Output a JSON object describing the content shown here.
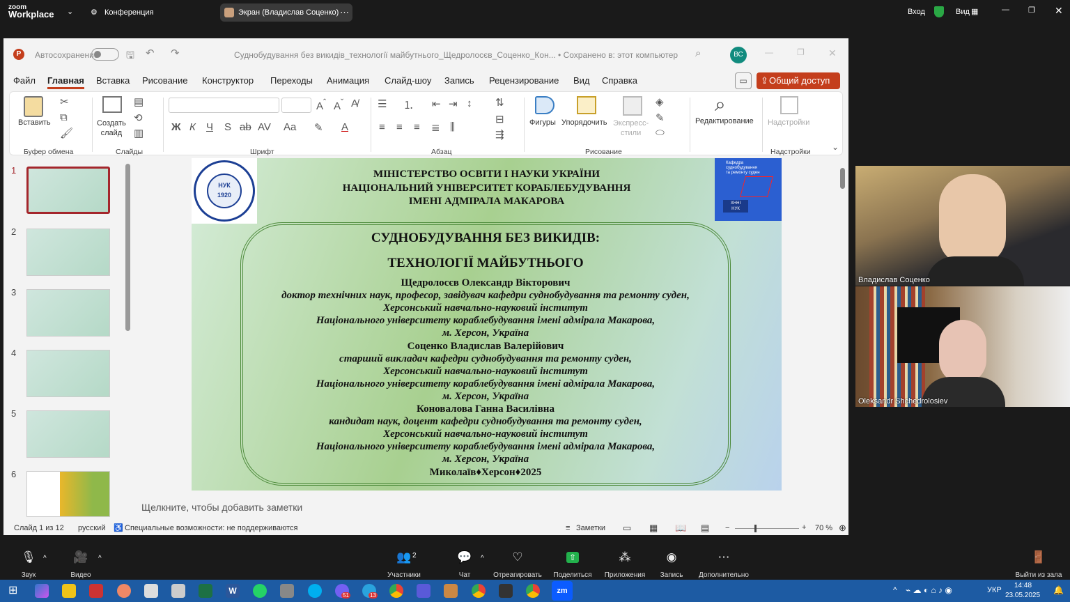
{
  "zoom_top": {
    "brand_line1": "zoom",
    "brand_line2": "Workplace",
    "meeting": "Конференция",
    "share_label": "Экран (Владислав Соценко)",
    "signin": "Вход",
    "view": "Вид"
  },
  "ppt": {
    "autosave": "Автосохранение",
    "doc_title": "Суднобудування без викидів_технології майбутнього_Щедролосєв_Соценко_Кон... • Сохранено в: этот компьютер",
    "user_initials": "ВС",
    "menu": [
      "Файл",
      "Главная",
      "Вставка",
      "Рисование",
      "Конструктор",
      "Переходы",
      "Анимация",
      "Слайд-шоу",
      "Запись",
      "Рецензирование",
      "Вид",
      "Справка"
    ],
    "share_button": "Общий доступ",
    "ribbon": {
      "paste": "Вставить",
      "new_slide_1": "Создать",
      "new_slide_2": "слайд",
      "shapes": "Фигуры",
      "arrange": "Упорядочить",
      "quick_styles_1": "Экспресс-",
      "quick_styles_2": "стили",
      "editing": "Редактирование",
      "addins": "Надстройки",
      "groups": [
        "Буфер обмена",
        "Слайды",
        "Шрифт",
        "Абзац",
        "Рисование",
        "Надстройки"
      ]
    },
    "thumb_numbers": [
      "1",
      "2",
      "3",
      "4",
      "5",
      "6"
    ],
    "notes_placeholder": "Щелкните, чтобы добавить заметки",
    "status": {
      "slide_of": "Слайд 1 из 12",
      "language": "русский",
      "accessibility": "Специальные возможности: не поддерживаются",
      "notes": "Заметки",
      "zoom": "70 %"
    }
  },
  "slide": {
    "header": [
      "МІНІСТЕРСТВО ОСВІТИ І НАУКИ УКРАЇНИ",
      "НАЦІОНАЛЬНИЙ УНІВЕРСИТЕТ КОРАБЛЕБУДУВАННЯ",
      "ІМЕНІ АДМІРАЛА МАКАРОВА"
    ],
    "logo_text": "НУК",
    "logo_year": "1920",
    "badge_lines": [
      "Кафедра",
      "суднобудування",
      "та ремонту суден"
    ],
    "badge_bottom": [
      "ХННІ",
      "НУК"
    ],
    "title1": "СУДНОБУДУВАННЯ БЕЗ ВИКИДІВ:",
    "title2": "ТЕХНОЛОГІЇ МАЙБУТНЬОГО",
    "author1_name": "Щедролосєв Олександр Вікторович",
    "author1_l1": "доктор технічних наук, професор, завідувач кафедри суднобудування та ремонту суден,",
    "author1_l2": "Херсонський навчально-науковий інститут",
    "author1_l3": "Національного університету кораблебудування імені адмірала Макарова,",
    "author1_l4": "м. Херсон, Україна",
    "author2_name": "Соценко Владислав Валерійович",
    "author2_l1": "старший викладач кафедри суднобудування та ремонту суден,",
    "author2_l2": "Херсонський навчально-науковий інститут",
    "author2_l3": "Національного університету кораблебудування імені адмірала Макарова,",
    "author2_l4": "м. Херсон, Україна",
    "author3_name": "Коновалова Ганна Василівна",
    "author3_l1": "кандидат наук, доцент кафедри суднобудування та ремонту суден,",
    "author3_l2": "Херсонський навчально-науковий інститут",
    "author3_l3": "Національного університету кораблебудування імені адмірала Макарова,",
    "author3_l4": "м. Херсон, Україна",
    "footer": "Миколаїв♦Херсон♦2025"
  },
  "participants": {
    "p1": "Владислав Соценко",
    "p2": "Oleksandr Shchedrolosiev"
  },
  "zoom_bottom": {
    "audio": "Звук",
    "video": "Видео",
    "participants": "Участники",
    "participants_count": "2",
    "chat": "Чат",
    "react": "Отреагировать",
    "share": "Поделиться",
    "apps": "Приложения",
    "record": "Запись",
    "more": "Дополнительно",
    "leave": "Выйти из зала"
  },
  "taskbar": {
    "lang": "УКР",
    "time": "14:48",
    "date": "23.05.2025",
    "badge_viber": "51",
    "badge_tg": "13"
  }
}
